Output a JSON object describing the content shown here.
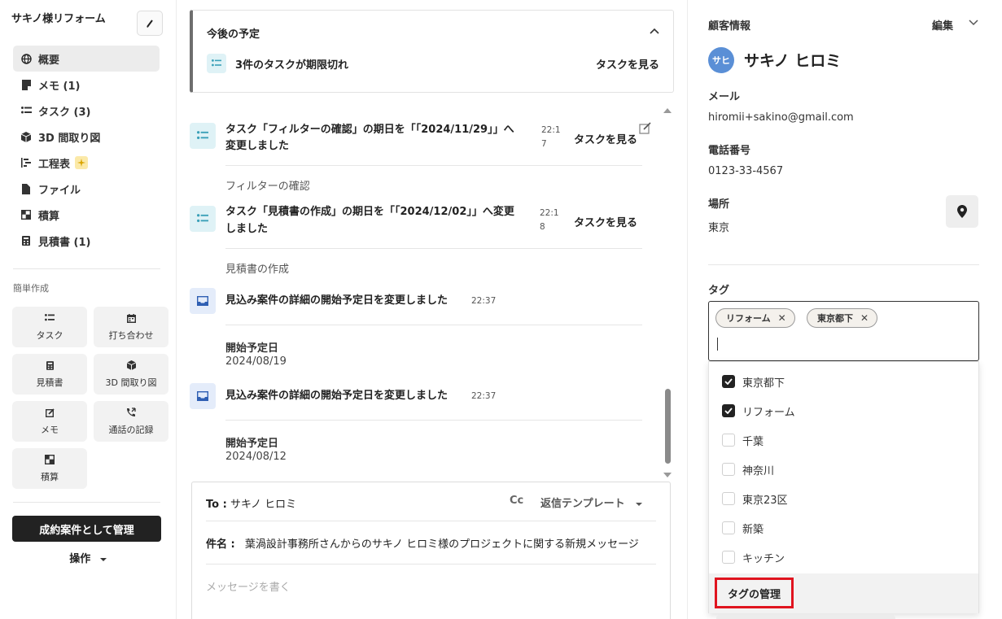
{
  "sidebar": {
    "title": "サキノ様リフォーム",
    "nav": [
      {
        "label": "概要",
        "icon": "globe-icon"
      },
      {
        "label": "メモ (1)",
        "icon": "memo-icon"
      },
      {
        "label": "タスク (3)",
        "icon": "task-list-icon"
      },
      {
        "label": "3D 間取り図",
        "icon": "cube-icon"
      },
      {
        "label": "工程表",
        "icon": "gantt-icon"
      },
      {
        "label": "ファイル",
        "icon": "file-icon"
      },
      {
        "label": "積算",
        "icon": "estimate-icon"
      },
      {
        "label": "見積書 (1)",
        "icon": "calculator-icon"
      }
    ],
    "quick_label": "簡単作成",
    "quick": [
      {
        "label": "タスク",
        "icon": "task-list-icon"
      },
      {
        "label": "打ち合わせ",
        "icon": "calendar-icon"
      },
      {
        "label": "見積書",
        "icon": "calculator-icon"
      },
      {
        "label": "3D 間取り図",
        "icon": "cube-icon"
      },
      {
        "label": "メモ",
        "icon": "edit-note-icon"
      },
      {
        "label": "通話の記録",
        "icon": "phone-call-icon"
      },
      {
        "label": "積算",
        "icon": "estimate-icon"
      }
    ],
    "primary_button": "成約案件として管理",
    "ops_label": "操作"
  },
  "upcoming": {
    "heading": "今後の予定",
    "overdue_text": "3件のタスクが期限切れ",
    "view_tasks": "タスクを見る"
  },
  "feed": {
    "items": [
      {
        "title_l1": "タスク「フィルターの確認」の期日を「「2024/11/29」」へ",
        "title_l2": "変更しました",
        "time_l1": "22:1",
        "time_l2": "7",
        "link": "タスクを見る",
        "sub": "フィルターの確認"
      },
      {
        "title_l1": "タスク「見積書の作成」の期日を「「2024/12/02」」へ変更",
        "title_l2": "しました",
        "time_l1": "22:1",
        "time_l2": "8",
        "link": "タスクを見る",
        "sub": "見積書の作成"
      },
      {
        "title": "見込み案件の詳細の開始予定日を変更しました",
        "time": "22:37",
        "label": "開始予定日",
        "value": "2024/08/19"
      },
      {
        "title": "見込み案件の詳細の開始予定日を変更しました",
        "time": "22:37",
        "label": "開始予定日",
        "value": "2024/08/12"
      }
    ]
  },
  "compose": {
    "to_label": "To :",
    "to_value": "サキノ ヒロミ",
    "cc": "Cc",
    "template": "返信テンプレート",
    "subject_label": "件名 :",
    "subject_value": "葉渦設計事務所さんからのサキノ ヒロミ様のプロジェクトに関する新規メッセージ",
    "message_placeholder": "メッセージを書く"
  },
  "customer": {
    "title": "顧客情報",
    "edit": "編集",
    "avatar_initials": "サヒ",
    "name": "サキノ ヒロミ",
    "email_label": "メール",
    "email": "hiromii+sakino@gmail.com",
    "phone_label": "電話番号",
    "phone": "0123-33-4567",
    "location_label": "場所",
    "location": "東京",
    "tags_label": "タグ",
    "selected_tags": [
      "リフォーム",
      "東京都下"
    ],
    "tag_options": [
      {
        "label": "東京都下",
        "checked": true
      },
      {
        "label": "リフォーム",
        "checked": true
      },
      {
        "label": "千葉",
        "checked": false
      },
      {
        "label": "神奈川",
        "checked": false
      },
      {
        "label": "東京23区",
        "checked": false
      },
      {
        "label": "新築",
        "checked": false
      },
      {
        "label": "キッチン",
        "checked": false
      }
    ],
    "manage_tags": "タグの管理"
  },
  "colors": {
    "accent_dark": "#222222",
    "highlight_border": "#e0141f",
    "avatar": "#5a8fd6",
    "task_icon_bg": "#dff2f6"
  }
}
